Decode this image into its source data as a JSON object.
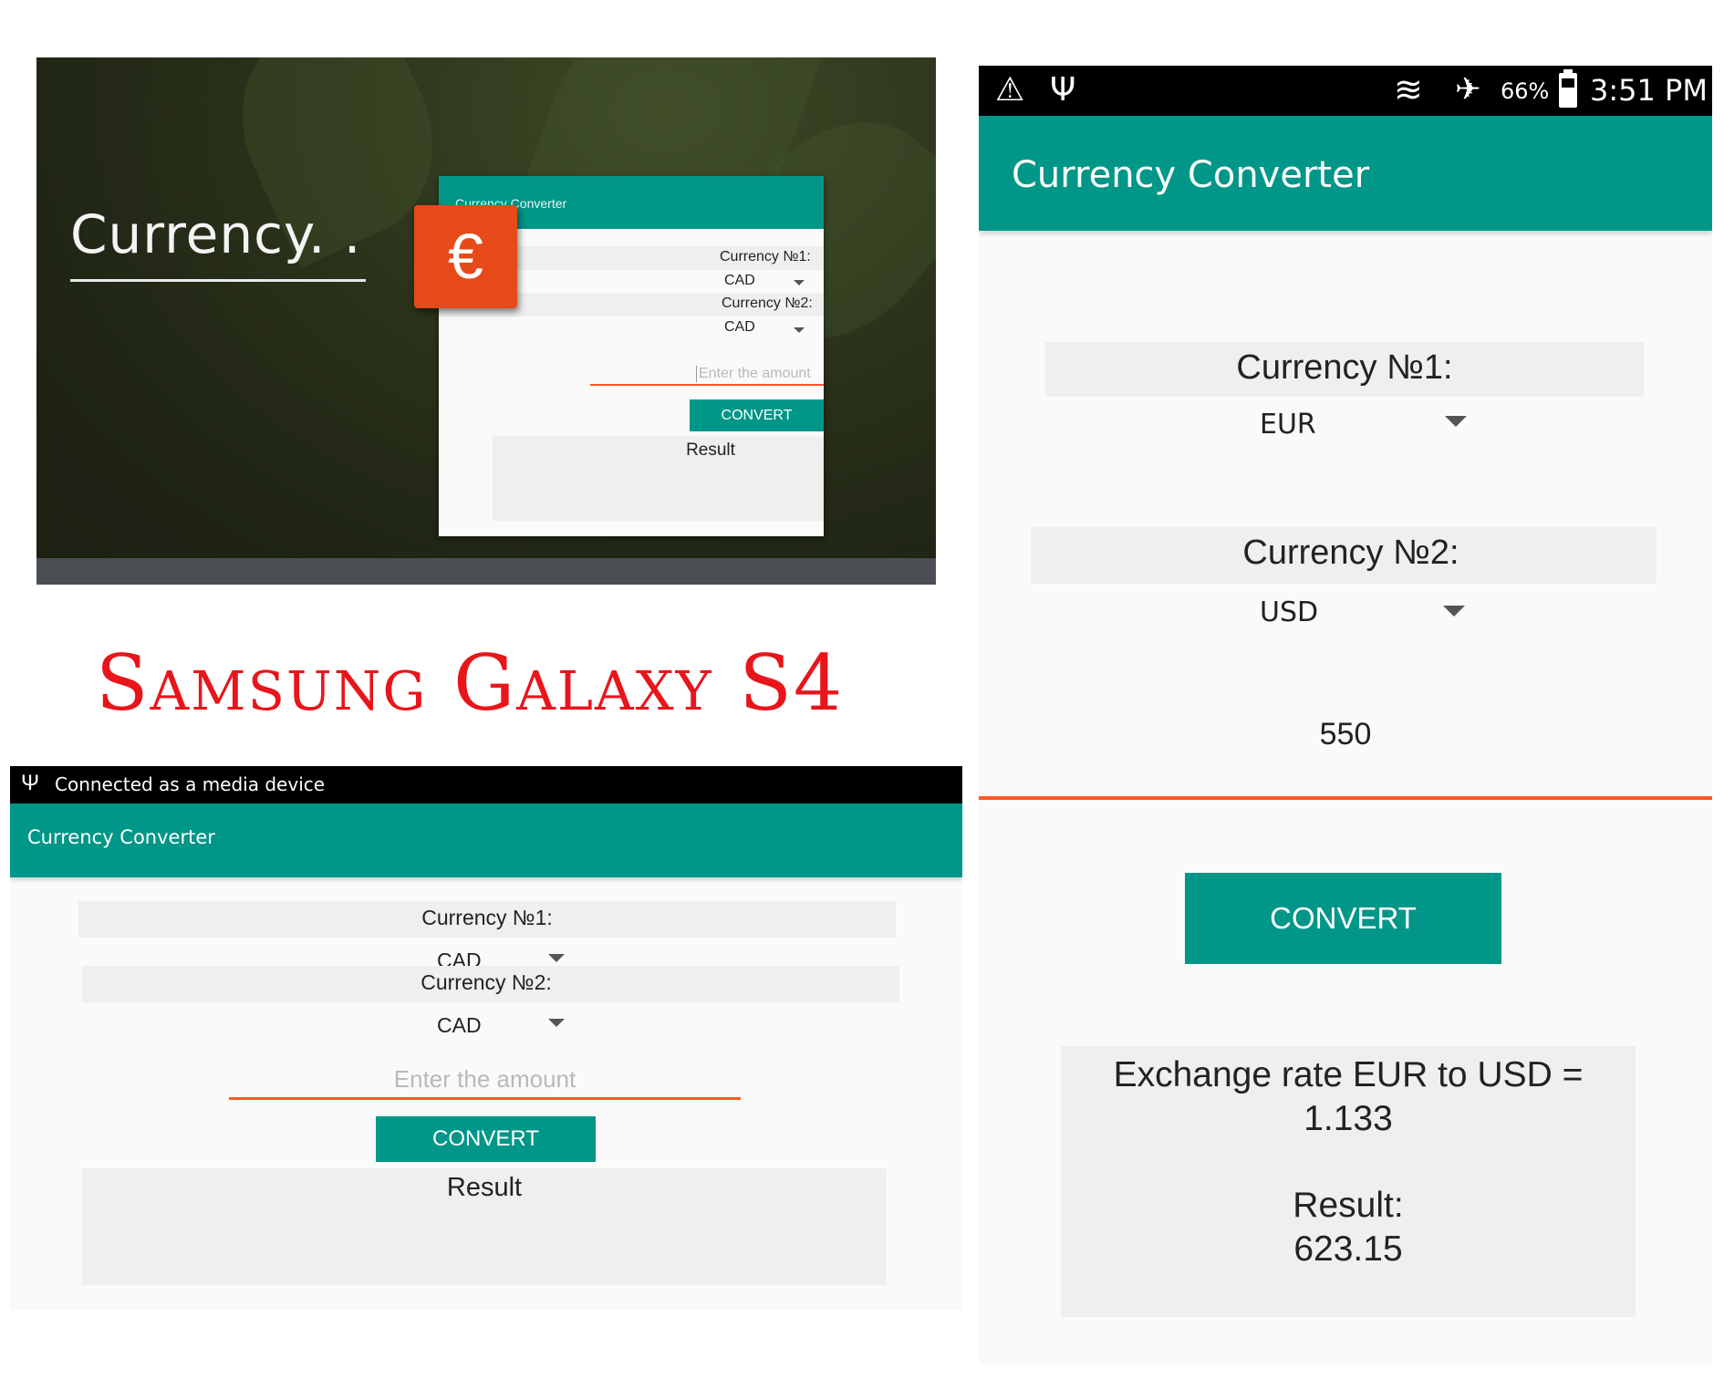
{
  "promo": {
    "headline": "Currency. .",
    "mini_app": {
      "title": "Currency Converter",
      "currency1_label": "Currency №1:",
      "currency1_value": "CAD",
      "currency2_label": "Currency №2:",
      "currency2_value": "CAD",
      "amount_placeholder": "Enter the amount",
      "convert_label": "CONVERT",
      "result": "Result"
    },
    "icon_glyph": "€"
  },
  "caption": "Samsung Galaxy S4",
  "phone_left": {
    "status_text": "Connected as a media device",
    "usb_glyph": "Ψ",
    "title": "Currency Converter",
    "currency1_label": "Currency №1:",
    "currency1_value": "CAD",
    "currency2_label": "Currency №2:",
    "currency2_value": "CAD",
    "amount_placeholder": "Enter the amount",
    "convert_label": "CONVERT",
    "result": "Result"
  },
  "phone_right": {
    "status": {
      "warning_glyph": "⚠",
      "usb_glyph": "Ψ",
      "wifi_glyph": "≋",
      "airplane_glyph": "✈",
      "battery": "66%",
      "time": "3:51 PM"
    },
    "title": "Currency Converter",
    "currency1_label": "Currency №1:",
    "currency1_value": "EUR",
    "currency2_label": "Currency №2:",
    "currency2_value": "USD",
    "amount_value": "550",
    "convert_label": "CONVERT",
    "rate_line1": "Exchange rate EUR to USD =",
    "rate_line2": "1.133",
    "result_label": "Result:",
    "result_value": "623.15"
  },
  "colors": {
    "teal": "#009688",
    "accent": "#ff5722",
    "caption": "#e8151b"
  }
}
